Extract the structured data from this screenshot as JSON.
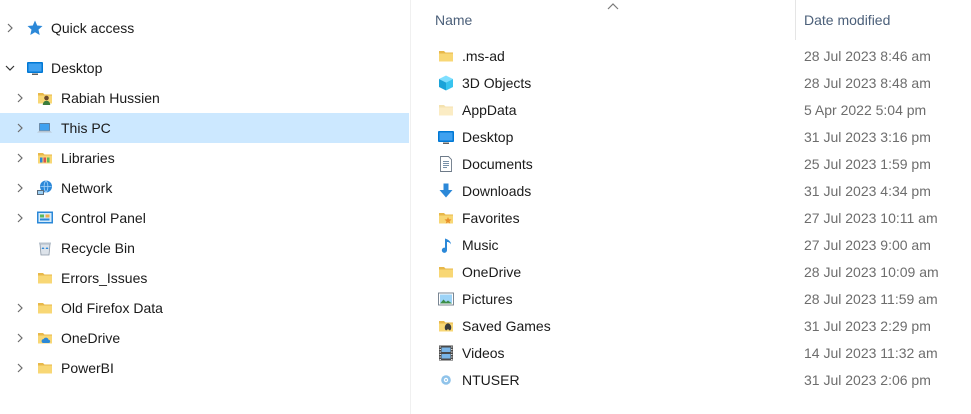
{
  "nav": {
    "items": [
      {
        "label": "Quick access",
        "icon": "star-icon",
        "expander": "collapsed"
      },
      {
        "label": "Desktop",
        "icon": "desktop-icon",
        "expander": "expanded"
      },
      {
        "label": "Rabiah Hussien",
        "icon": "user-folder-icon",
        "expander": "collapsed"
      },
      {
        "label": "This PC",
        "icon": "computer-icon",
        "expander": "collapsed",
        "selected": true
      },
      {
        "label": "Libraries",
        "icon": "library-icon",
        "expander": "collapsed"
      },
      {
        "label": "Network",
        "icon": "network-icon",
        "expander": "collapsed"
      },
      {
        "label": "Control Panel",
        "icon": "control-panel-icon",
        "expander": "collapsed"
      },
      {
        "label": "Recycle Bin",
        "icon": "recycle-bin-icon",
        "expander": "none"
      },
      {
        "label": "Errors_Issues",
        "icon": "folder-icon",
        "expander": "none"
      },
      {
        "label": "Old Firefox Data",
        "icon": "folder-icon",
        "expander": "collapsed"
      },
      {
        "label": "OneDrive",
        "icon": "onedrive-folder-icon",
        "expander": "collapsed"
      },
      {
        "label": "PowerBI",
        "icon": "folder-icon",
        "expander": "collapsed"
      }
    ]
  },
  "file_list": {
    "columns": {
      "name": "Name",
      "date_modified": "Date modified"
    },
    "sort": {
      "column": "Name",
      "direction": "ascending"
    },
    "rows": [
      {
        "name": ".ms-ad",
        "date": "28 Jul 2023 8:46 am",
        "icon": "folder-icon"
      },
      {
        "name": "3D Objects",
        "date": "28 Jul 2023 8:48 am",
        "icon": "3d-objects-icon"
      },
      {
        "name": "AppData",
        "date": "5 Apr 2022 5:04 pm",
        "icon": "folder-hidden-icon"
      },
      {
        "name": "Desktop",
        "date": "31 Jul 2023 3:16 pm",
        "icon": "desktop-icon"
      },
      {
        "name": "Documents",
        "date": "25 Jul 2023 1:59 pm",
        "icon": "documents-icon"
      },
      {
        "name": "Downloads",
        "date": "31 Jul 2023 4:34 pm",
        "icon": "downloads-icon"
      },
      {
        "name": "Favorites",
        "date": "27 Jul 2023 10:11 am",
        "icon": "favorites-icon"
      },
      {
        "name": "Music",
        "date": "27 Jul 2023 9:00 am",
        "icon": "music-icon"
      },
      {
        "name": "OneDrive",
        "date": "28 Jul 2023 10:09 am",
        "icon": "folder-icon"
      },
      {
        "name": "Pictures",
        "date": "28 Jul 2023 11:59 am",
        "icon": "pictures-icon"
      },
      {
        "name": "Saved Games",
        "date": "31 Jul 2023 2:29 pm",
        "icon": "saved-games-icon"
      },
      {
        "name": "Videos",
        "date": "14 Jul 2023 11:32 am",
        "icon": "videos-icon"
      },
      {
        "name": "NTUSER",
        "date": "31 Jul 2023 2:06 pm",
        "icon": "system-file-icon"
      }
    ]
  },
  "colors": {
    "selection": "#cce8ff",
    "header_text": "#4c607a",
    "date_text": "#6d6d6d",
    "folder_yellow": "#f8d775",
    "accent_blue": "#0078d4"
  }
}
